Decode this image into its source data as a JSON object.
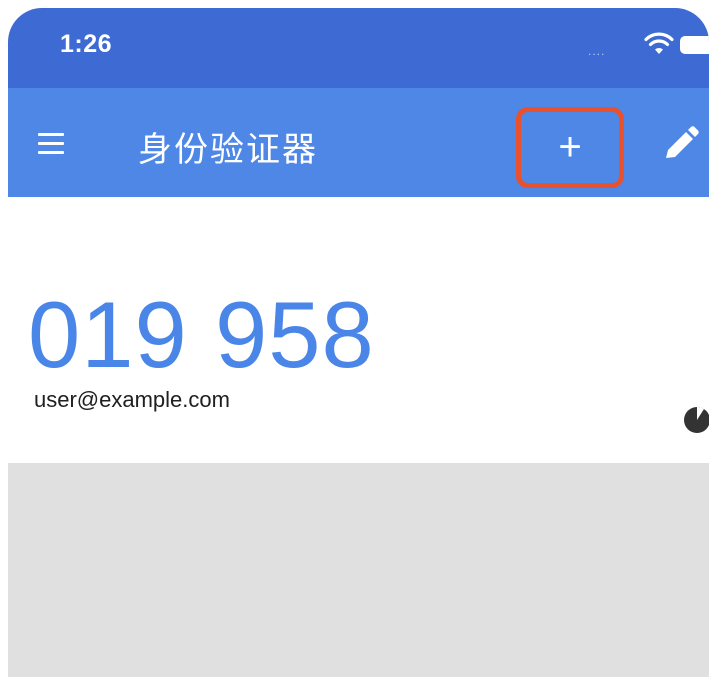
{
  "status_bar": {
    "time": "1:26",
    "signal": "....",
    "wifi_icon": "wifi-icon",
    "battery_icon": "battery-icon"
  },
  "app_bar": {
    "menu_icon": "menu-icon",
    "title": "身份验证器",
    "add_icon": "plus-icon",
    "add_label": "+",
    "edit_icon": "pencil-icon",
    "highlight_color": "#e8512d"
  },
  "accounts": [
    {
      "code": "019 958",
      "email": "user@example.com",
      "timer_icon": "countdown-timer-icon"
    }
  ],
  "colors": {
    "status_bar": "#3d6bd3",
    "app_bar": "#4f87e7",
    "code": "#4a86e8",
    "background_empty": "#e0e0e0"
  }
}
